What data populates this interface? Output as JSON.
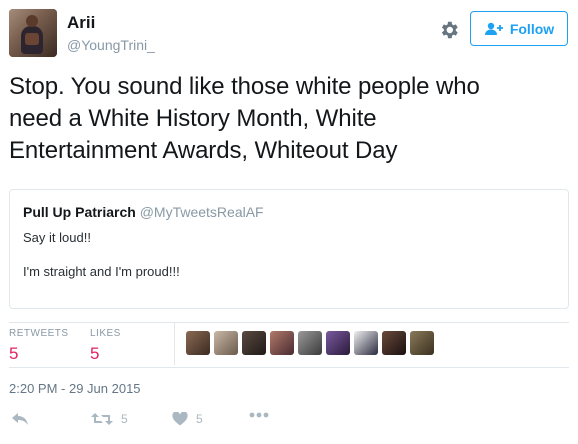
{
  "user": {
    "name": "Arii",
    "handle": "@YoungTrini_"
  },
  "header": {
    "follow_label": "Follow"
  },
  "tweet": {
    "text_lines": [
      "Stop. You sound like those white people who",
      "need a White History Month, White",
      "Entertainment Awards, Whiteout Day"
    ]
  },
  "quote": {
    "author_name": "Pull Up Patriarch",
    "author_handle": "@MyTweetsRealAF",
    "line1": "Say it loud!!",
    "line2": "I'm straight and I'm proud!!!"
  },
  "stats": {
    "retweets_label": "RETWEETS",
    "retweets_count": "5",
    "likes_label": "LIKES",
    "likes_count": "5"
  },
  "timestamp": "2:20 PM - 29 Jun 2015",
  "actions": {
    "retweet_count": "5",
    "like_count": "5"
  },
  "colors": {
    "accent_blue": "#1da1f2",
    "like_red": "#e0245e",
    "muted": "#8899a6"
  }
}
